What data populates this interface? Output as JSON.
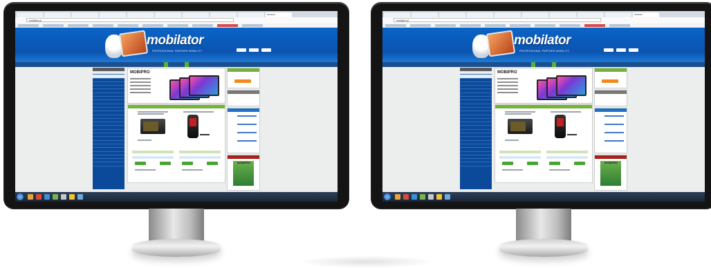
{
  "site": {
    "logo": "mobilator",
    "tagline": "PROFESSIONAL PARTNER MOBILITY",
    "url": "mobilator.pl"
  },
  "browser": {
    "tabs": [
      "",
      "",
      "",
      "",
      "",
      "",
      "",
      "",
      "",
      "Mobilator"
    ]
  },
  "nav": {
    "items": [
      "",
      "",
      "",
      "",
      "",
      "",
      "",
      "",
      "",
      ""
    ]
  },
  "promo": {
    "brand": "MOBIPRO"
  },
  "product_section": {
    "header": ""
  },
  "sidebar_right": {
    "ad_brand": "MOBIPRO"
  },
  "colors": {
    "banner": "#0b54b0",
    "nav": "#1b4f8f",
    "accent_green": "#74b33a",
    "accent_orange": "#f08a1c",
    "taskbar": "#1a2638"
  },
  "icons": [
    "windows-start-icon",
    "browser-icon",
    "folder-icon",
    "media-icon"
  ]
}
